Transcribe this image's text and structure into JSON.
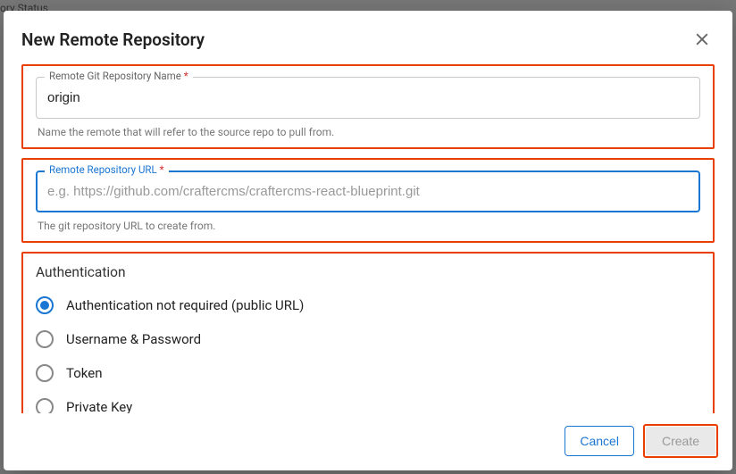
{
  "background": {
    "partial_label": "ory Status"
  },
  "modal": {
    "title": "New Remote Repository",
    "fields": {
      "name": {
        "label": "Remote Git Repository Name",
        "required": "*",
        "value": "origin",
        "helper": "Name the remote that will refer to the source repo to pull from."
      },
      "url": {
        "label": "Remote Repository URL",
        "required": "*",
        "placeholder": "e.g. https://github.com/craftercms/craftercms-react-blueprint.git",
        "value": "",
        "helper": "The git repository URL to create from."
      }
    },
    "auth": {
      "title": "Authentication",
      "options": [
        {
          "label": "Authentication not required (public URL)",
          "checked": true
        },
        {
          "label": "Username & Password",
          "checked": false
        },
        {
          "label": "Token",
          "checked": false
        },
        {
          "label": "Private Key",
          "checked": false
        }
      ]
    },
    "footer": {
      "cancel": "Cancel",
      "create": "Create"
    }
  }
}
